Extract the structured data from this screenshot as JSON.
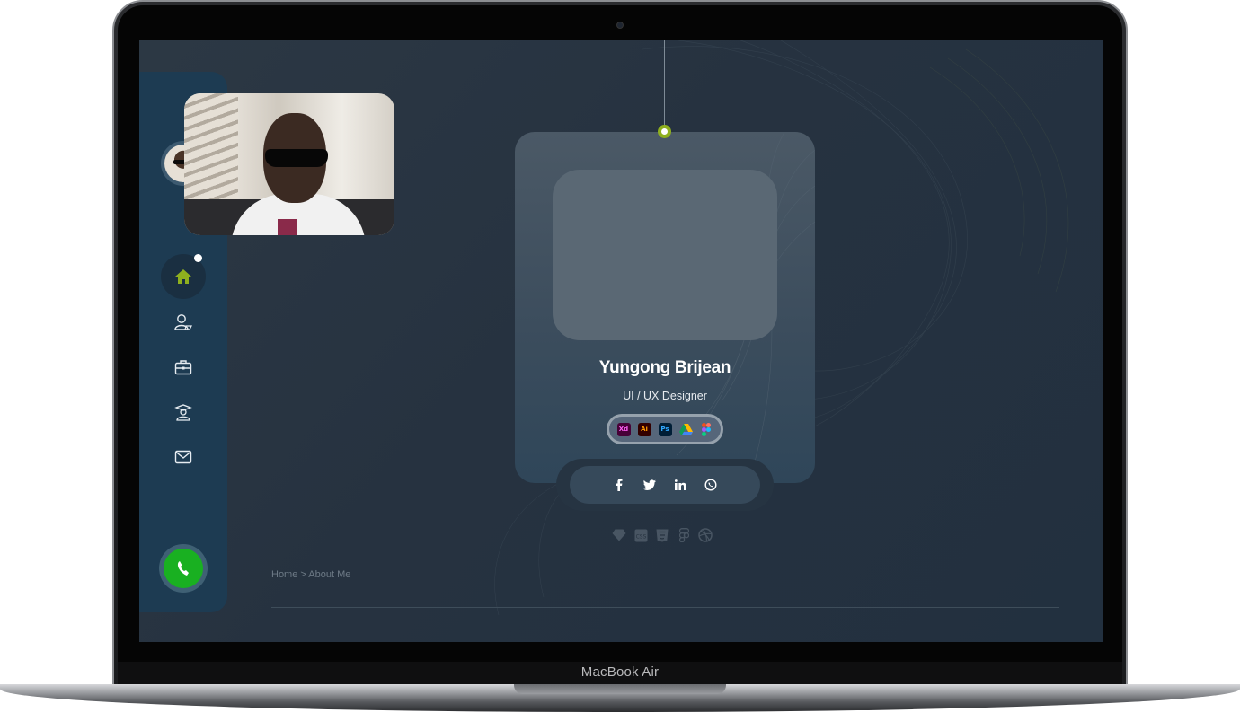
{
  "device": {
    "label": "MacBook Air"
  },
  "sidebar": {
    "items": [
      {
        "name": "home",
        "icon": "home-icon",
        "active": true
      },
      {
        "name": "about",
        "icon": "user-icon"
      },
      {
        "name": "portfolio",
        "icon": "briefcase-icon"
      },
      {
        "name": "education",
        "icon": "graduate-icon"
      },
      {
        "name": "contact",
        "icon": "mail-icon"
      }
    ],
    "call_icon": "phone-icon"
  },
  "profile": {
    "name": "Yungong Brijean",
    "role": "UI / UX Designer",
    "tools": [
      "Xd",
      "Ai",
      "Ps",
      "drive-icon",
      "figma-icon"
    ]
  },
  "social": [
    "facebook-icon",
    "twitter-icon",
    "linkedin-icon",
    "whatsapp-icon"
  ],
  "skills": [
    "sketch-icon",
    "css-icon",
    "html5-icon",
    "figma-icon",
    "dribbble-icon"
  ],
  "breadcrumb": {
    "text": "Home > About Me"
  },
  "colors": {
    "accent": "#8fb01e",
    "sidebar": "#1d3b52",
    "call": "#19b021",
    "screen_bg": "#263240"
  }
}
